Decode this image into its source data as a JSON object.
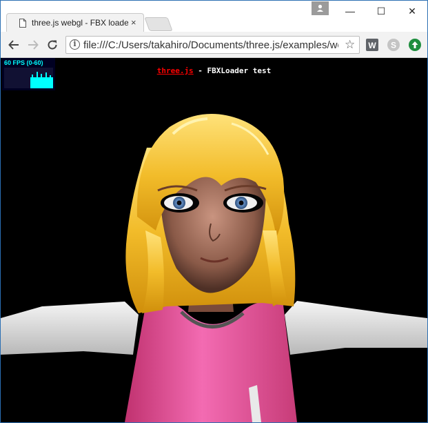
{
  "tab": {
    "title": "three.js webgl - FBX loader",
    "close": "×"
  },
  "window_controls": {
    "minimize": "—",
    "maximize": "☐",
    "close": "✕"
  },
  "toolbar": {
    "url": "file:///C:/Users/takahiro/Documents/three.js/examples/webgl_loader_fbx.html",
    "back_icon": "arrow-left-icon",
    "forward_icon": "arrow-right-icon",
    "reload_icon": "reload-icon",
    "star_icon": "star-icon"
  },
  "extensions": [
    {
      "name": "w-extension-icon",
      "letter": "W",
      "color": "#5f6368"
    },
    {
      "name": "skype-extension-icon",
      "letter": "S",
      "color": "#a0a0a0"
    },
    {
      "name": "upload-extension-icon",
      "letter": "↑",
      "color": "#1e8e3e"
    }
  ],
  "stats": {
    "label": "60 FPS (0-60)",
    "color": "#00ffff"
  },
  "page": {
    "title_link": "three.js",
    "title_rest": " - FBXLoader test",
    "link_color": "#ff0000"
  }
}
